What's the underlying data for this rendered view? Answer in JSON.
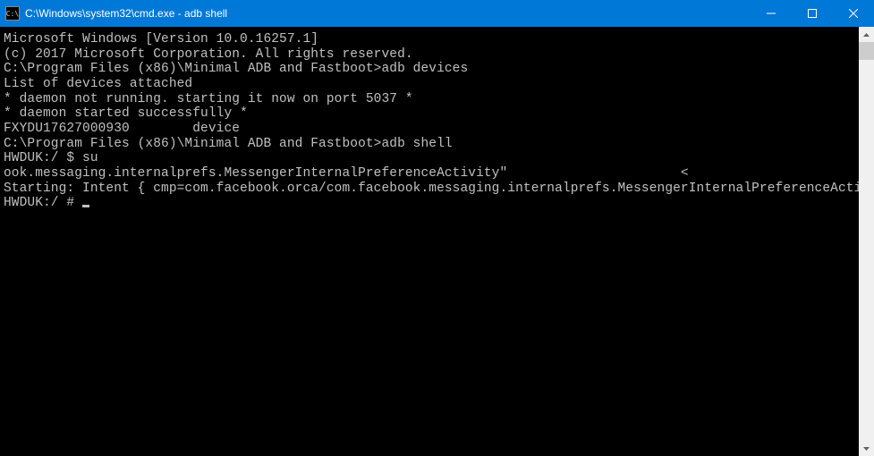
{
  "titlebar": {
    "title": "C:\\Windows\\system32\\cmd.exe - adb  shell",
    "icon_label": "cmd-icon"
  },
  "terminal": {
    "lines": [
      "Microsoft Windows [Version 10.0.16257.1]",
      "(c) 2017 Microsoft Corporation. All rights reserved.",
      "",
      "C:\\Program Files (x86)\\Minimal ADB and Fastboot>adb devices",
      "List of devices attached",
      "* daemon not running. starting it now on port 5037 *",
      "* daemon started successfully *",
      "FXYDU17627000930        device",
      "",
      "",
      "C:\\Program Files (x86)\\Minimal ADB and Fastboot>adb shell",
      "HWDUK:/ $ su",
      "ook.messaging.internalprefs.MessengerInternalPreferenceActivity\"                      <",
      "Starting: Intent { cmp=com.facebook.orca/com.facebook.messaging.internalprefs.MessengerInternalPreferenceActivity }",
      "HWDUK:/ # "
    ]
  }
}
